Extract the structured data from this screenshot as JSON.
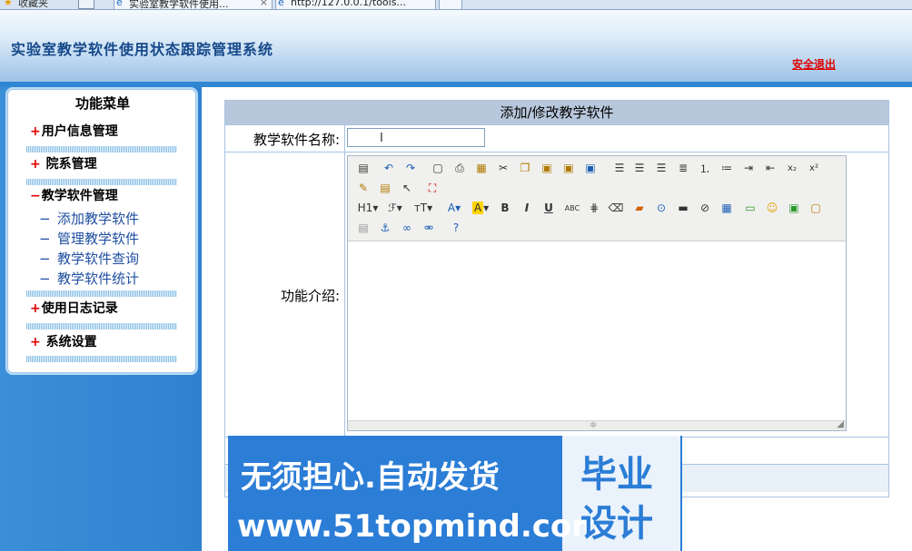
{
  "browser": {
    "favorites_label": "收藏夹",
    "tabs": [
      {
        "title": "实验室教学软件使用...",
        "close": "×"
      },
      {
        "title": "http://127.0.0.1/tools..."
      }
    ]
  },
  "header": {
    "title": "实验室教学软件使用状态跟踪管理系统",
    "logout_label": "安全退出"
  },
  "sidebar": {
    "title": "功能菜单",
    "sections": [
      {
        "marker": "+",
        "label": "用户信息管理"
      },
      {
        "marker": "+ ",
        "label": "院系管理"
      },
      {
        "marker": "−",
        "label": "教学软件管理"
      },
      {
        "marker": "+",
        "label": "使用日志记录"
      },
      {
        "marker": "+ ",
        "label": "系统设置"
      }
    ],
    "subitems": [
      {
        "dash": "−",
        "label": "添加教学软件"
      },
      {
        "dash": "−",
        "label": "管理教学软件"
      },
      {
        "dash": "−",
        "label": "教学软件查询"
      },
      {
        "dash": "−",
        "label": "教学软件统计"
      }
    ]
  },
  "form": {
    "heading": "添加/修改教学软件",
    "name_label": "教学软件名称:",
    "name_value": "",
    "intro_label": "功能介绍:"
  },
  "editor": {
    "toolbar_row1": [
      "source-icon",
      "undo-icon",
      "redo-icon",
      "preview-icon",
      "print-icon",
      "template-icon",
      "cut-icon",
      "copy-icon",
      "paste-icon",
      "paste-text-icon",
      "paste-word-icon",
      "align-left-icon",
      "align-center-icon",
      "align-right-icon",
      "justify-icon",
      "ordered-list-icon",
      "unordered-list-icon",
      "indent-icon",
      "outdent-icon",
      "subscript-icon",
      "superscript-icon"
    ],
    "toolbar_row2": [
      "clear-format-icon",
      "select-all-icon",
      "cursor-icon",
      "fullscreen-icon"
    ],
    "toolbar_row3_text": {
      "heading": "H1",
      "font": "ℱ",
      "size": "тT",
      "forecolor": "A",
      "highlight": "A",
      "bold": "B",
      "italic": "I",
      "underline": "U",
      "strike": "ABC"
    },
    "toolbar_row4": [
      "page-break-icon",
      "anchor-icon",
      "link-icon",
      "unlink-icon",
      "help-icon"
    ]
  },
  "watermark": {
    "line1": "无须担心.自动发货",
    "line2": "www.51topmind.com",
    "box_line1": "毕业",
    "box_line2": "设计"
  },
  "colors": {
    "accent_blue": "#2f86d2",
    "title_blue": "#16498a",
    "logout_red": "#e00000",
    "menu_plus_red": "#e00000",
    "sub_link_blue": "#1f4fa0",
    "panel_head": "#b8c8dc"
  }
}
